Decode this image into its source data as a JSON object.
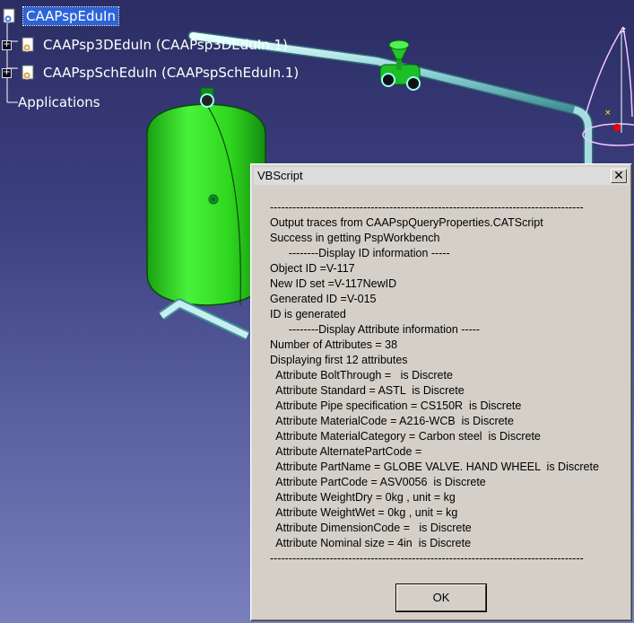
{
  "tree": {
    "root_label": "CAAPspEduIn",
    "items": [
      {
        "label": "CAAPsp3DEduIn (CAAPsp3DEduIn.1)"
      },
      {
        "label": "CAAPspSchEduIn (CAAPspSchEduIn.1)"
      },
      {
        "label": "Applications"
      }
    ]
  },
  "scene": {
    "tank_color": "#2fd61f",
    "pipe_color": "#9fd8dc",
    "valve_color": "#22c42a"
  },
  "dialog": {
    "title": "VBScript",
    "close_glyph": "✕",
    "lines": [
      "------------------------------------------------------------------------------------",
      "Output traces from CAAPspQueryProperties.CATScript",
      "Success in getting PspWorkbench",
      "      --------Display ID information -----",
      "Object ID =V-117",
      "New ID set =V-117NewID",
      "Generated ID =V-015",
      "ID is generated",
      "      --------Display Attribute information -----",
      "Number of Attributes = 38",
      "Displaying first 12 attributes",
      "  Attribute BoltThrough =   is Discrete",
      "  Attribute Standard = ASTL  is Discrete",
      "  Attribute Pipe specification = CS150R  is Discrete",
      "  Attribute MaterialCode = A216-WCB  is Discrete",
      "  Attribute MaterialCategory = Carbon steel  is Discrete",
      "  Attribute AlternatePartCode =",
      "  Attribute PartName = GLOBE VALVE. HAND WHEEL  is Discrete",
      "  Attribute PartCode = ASV0056  is Discrete",
      "  Attribute WeightDry = 0kg , unit = kg",
      "  Attribute WeightWet = 0kg , unit = kg",
      "  Attribute DimensionCode =   is Discrete",
      "  Attribute Nominal size = 4in  is Discrete",
      "------------------------------------------------------------------------------------"
    ],
    "ok_label": "OK"
  }
}
